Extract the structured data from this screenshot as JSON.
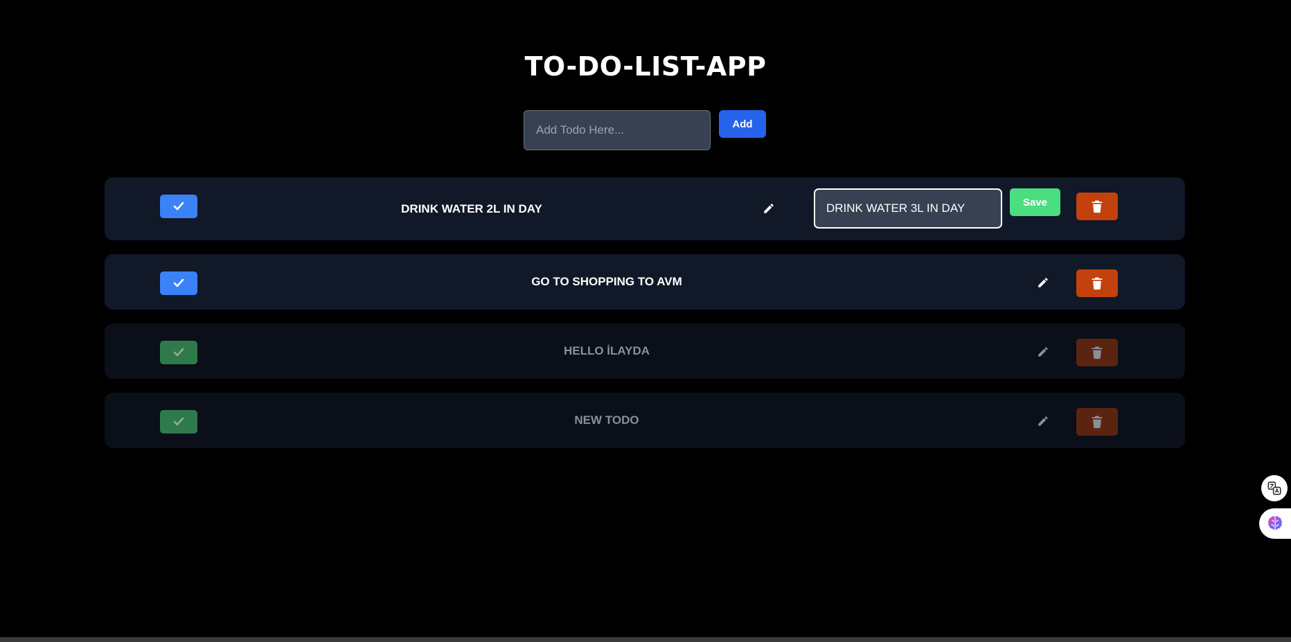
{
  "app": {
    "title": "TO-DO-LIST-APP"
  },
  "add_form": {
    "placeholder": "Add Todo Here...",
    "value": "",
    "add_label": "Add"
  },
  "todos": [
    {
      "text": "DRINK WATER 2L IN DAY",
      "completed": false,
      "editing": true,
      "edit_value": "DRINK WATER 3L IN DAY",
      "save_label": "Save"
    },
    {
      "text": "GO TO SHOPPING TO AVM",
      "completed": false,
      "editing": false
    },
    {
      "text": "HELLO İLAYDA",
      "completed": true,
      "editing": false
    },
    {
      "text": "NEW TODO",
      "completed": true,
      "editing": false
    }
  ],
  "icons": {
    "check": "check-icon",
    "edit": "pencil-icon",
    "delete": "trash-icon",
    "translate": "translate-icon",
    "assistant": "brain-icon"
  },
  "colors": {
    "background": "#000000",
    "row": "#111827",
    "row_done": "#0b0f19",
    "check_active": "#3b82f6",
    "check_done": "#2f7a4a",
    "delete": "#c2410c",
    "add_button": "#2563eb",
    "save_button": "#4ade80"
  }
}
